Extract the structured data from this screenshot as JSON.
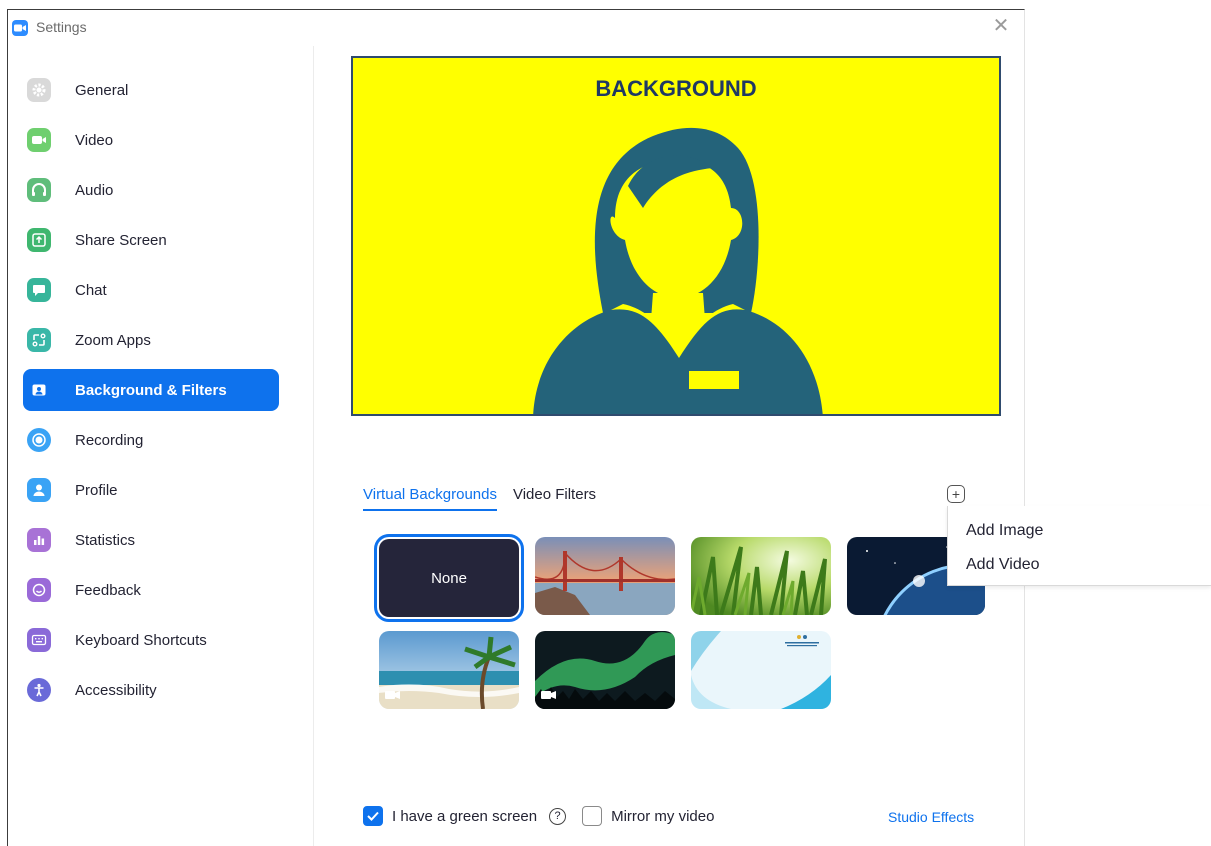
{
  "window": {
    "title": "Settings",
    "close_glyph": "✕"
  },
  "sidebar": {
    "items": [
      {
        "label": "General",
        "icon": "gear-icon",
        "color": "#d6d6d6"
      },
      {
        "label": "Video",
        "icon": "video-camera-icon",
        "color": "#6fcf6f"
      },
      {
        "label": "Audio",
        "icon": "headphones-icon",
        "color": "#5fbd7b"
      },
      {
        "label": "Share Screen",
        "icon": "share-screen-icon",
        "color": "#3fb76f"
      },
      {
        "label": "Chat",
        "icon": "chat-icon",
        "color": "#37b59a"
      },
      {
        "label": "Zoom Apps",
        "icon": "zoom-apps-icon",
        "color": "#3ab7a8"
      },
      {
        "label": "Background & Filters",
        "icon": "background-icon",
        "color": "#0e72ed",
        "active": true
      },
      {
        "label": "Recording",
        "icon": "recording-icon",
        "color": "#3aa3f5"
      },
      {
        "label": "Profile",
        "icon": "profile-icon",
        "color": "#3aa3f5"
      },
      {
        "label": "Statistics",
        "icon": "statistics-icon",
        "color": "#a872d6"
      },
      {
        "label": "Feedback",
        "icon": "feedback-icon",
        "color": "#9a6ad8"
      },
      {
        "label": "Keyboard Shortcuts",
        "icon": "keyboard-icon",
        "color": "#8a6ad8"
      },
      {
        "label": "Accessibility",
        "icon": "accessibility-icon",
        "color": "#6a6ad8"
      }
    ]
  },
  "preview": {
    "title": "BACKGROUND",
    "bg_color": "#ffff00",
    "figure_color": "#24637a"
  },
  "tabs": [
    {
      "label": "Virtual Backgrounds",
      "active": true
    },
    {
      "label": "Video Filters",
      "active": false
    }
  ],
  "add_button": {
    "glyph": "+"
  },
  "thumbnails": [
    {
      "name": "none",
      "label": "None",
      "selected": true
    },
    {
      "name": "golden-gate-bridge"
    },
    {
      "name": "grass"
    },
    {
      "name": "earth-from-space"
    },
    {
      "name": "beach-palm",
      "video": true
    },
    {
      "name": "northern-lights",
      "video": true
    },
    {
      "name": "document-template"
    }
  ],
  "footer": {
    "green_screen_label": "I have a green screen",
    "green_screen_checked": true,
    "help_glyph": "?",
    "mirror_label": "Mirror my video",
    "mirror_checked": false,
    "studio_effects_label": "Studio Effects"
  },
  "menu": {
    "items": [
      {
        "label": "Add Image"
      },
      {
        "label": "Add Video"
      }
    ]
  }
}
